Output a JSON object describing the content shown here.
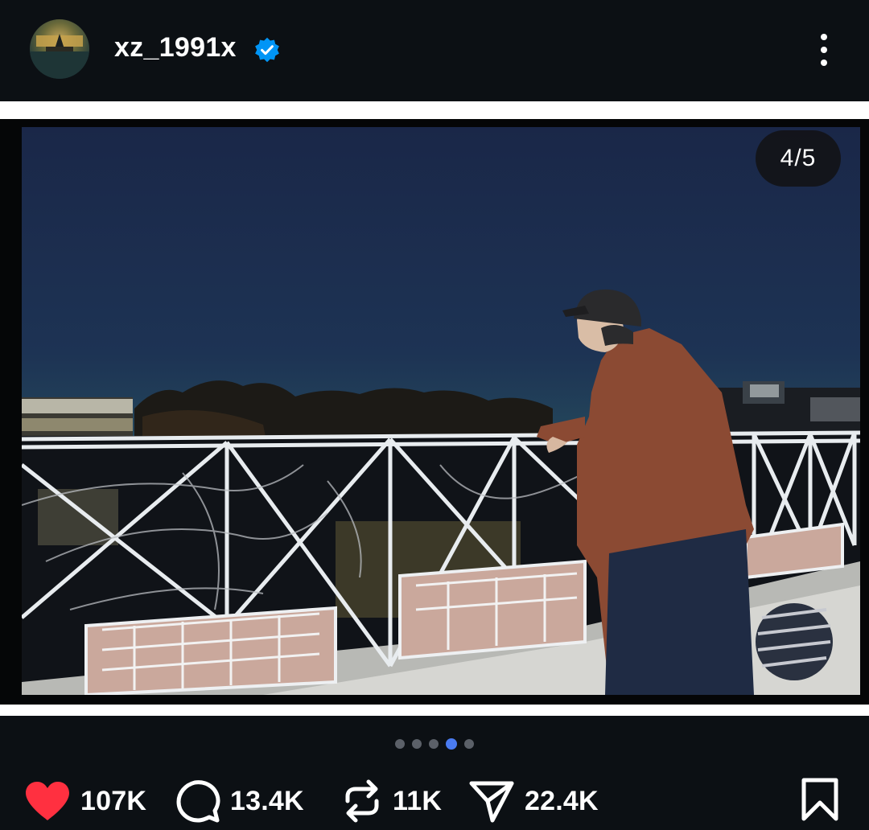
{
  "header": {
    "username": "xz_1991x",
    "verified": true,
    "avatar_icon": "avatar",
    "more_icon": "more-vertical-icon"
  },
  "post": {
    "image_counter": "4/5",
    "carousel": {
      "total": 5,
      "active_index": 4
    }
  },
  "actions": {
    "likes": "107K",
    "comments": "13.4K",
    "reposts": "11K",
    "shares": "22.4K",
    "like_icon": "heart-icon",
    "comment_icon": "comment-icon",
    "repost_icon": "repost-icon",
    "share_icon": "share-icon",
    "bookmark_icon": "bookmark-icon"
  },
  "colors": {
    "background": "#0c1014",
    "like": "#ff3040",
    "verified": "#0095f6",
    "active_dot": "#4a7bf0"
  }
}
